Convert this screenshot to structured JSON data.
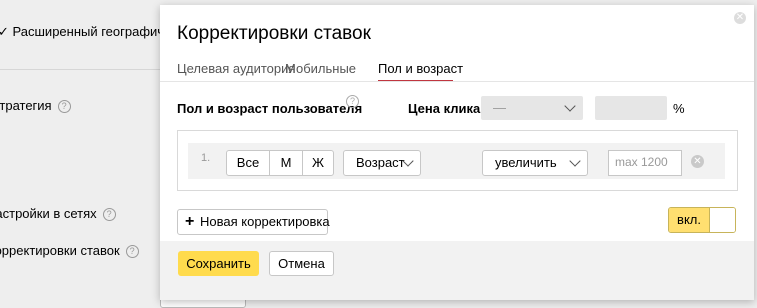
{
  "background": {
    "items": [
      {
        "label": "Расширенный географический таргетинг"
      },
      {
        "label": "Стратегия"
      },
      {
        "label": "Настройки в сетях"
      },
      {
        "label": "Корректировки ставок"
      }
    ]
  },
  "modal": {
    "title": "Корректировки ставок",
    "close_icon": "close-icon",
    "tabs": [
      {
        "label": "Целевая аудитория",
        "active": false
      },
      {
        "label": "Мобильные",
        "active": false
      },
      {
        "label": "Пол и возраст",
        "active": true
      }
    ],
    "section_label": "Пол и возраст пользователя",
    "price_label": "Цена клика",
    "price_select_value": "—",
    "price_unit": "%",
    "row": {
      "index": "1.",
      "gender": [
        "Все",
        "М",
        "Ж"
      ],
      "age_select": "Возраст",
      "action_select": "увеличить",
      "input_placeholder": "max 1200",
      "input_value": ""
    },
    "add_button": "Новая корректировка",
    "toggle_label": "вкл.",
    "toggle_on": true,
    "save_button": "Сохранить",
    "cancel_button": "Отмена"
  },
  "colors": {
    "accent_yellow": "#ffdb4d",
    "tab_underline": "#c0353f"
  }
}
